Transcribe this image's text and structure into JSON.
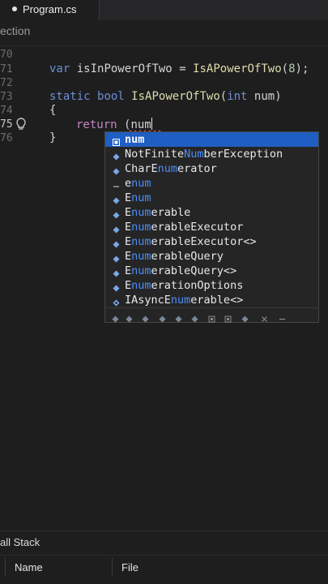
{
  "tab": {
    "filename": "Program.cs"
  },
  "section_label": "ection",
  "editor": {
    "lines": [
      {
        "num": "70"
      },
      {
        "num": "71"
      },
      {
        "num": "72"
      },
      {
        "num": "73"
      },
      {
        "num": "74"
      },
      {
        "num": "75"
      },
      {
        "num": "76"
      }
    ],
    "line71": {
      "kw": "var",
      "name": "isInPowerOfTwo",
      "eq": "=",
      "fn": "IsAPowerOfTwo",
      "open": "(",
      "arg": "8",
      "close": ");"
    },
    "line73": {
      "kw1": "static",
      "kw2": "bool",
      "fn": "IsAPowerOfTwo",
      "open": "(",
      "ptype": "int",
      "pname": "num",
      "close": ")"
    },
    "line74": {
      "text": "{"
    },
    "line75": {
      "kw": "return",
      "text": "(num"
    },
    "line76": {
      "text": "}"
    }
  },
  "completion": {
    "items": [
      {
        "pre": "",
        "match": "num",
        "post": "",
        "kind": "local"
      },
      {
        "pre": "NotFinite",
        "match": "Num",
        "post": "berException",
        "kind": "class"
      },
      {
        "pre": "CharE",
        "match": "num",
        "post": "erator",
        "kind": "class"
      },
      {
        "pre": "e",
        "match": "num",
        "post": "",
        "kind": "keyword"
      },
      {
        "pre": "E",
        "match": "num",
        "post": "",
        "kind": "class"
      },
      {
        "pre": "E",
        "match": "num",
        "post": "erable",
        "kind": "class"
      },
      {
        "pre": "E",
        "match": "num",
        "post": "erableExecutor",
        "kind": "class"
      },
      {
        "pre": "E",
        "match": "num",
        "post": "erableExecutor<>",
        "kind": "class"
      },
      {
        "pre": "E",
        "match": "num",
        "post": "erableQuery",
        "kind": "class"
      },
      {
        "pre": "E",
        "match": "num",
        "post": "erableQuery<>",
        "kind": "class"
      },
      {
        "pre": "E",
        "match": "num",
        "post": "erationOptions",
        "kind": "class"
      },
      {
        "pre": "IAsyncE",
        "match": "num",
        "post": "erable<>",
        "kind": "interface"
      }
    ],
    "filter_icons": [
      "class-filter-icon",
      "struct-filter-icon",
      "interface-filter-icon",
      "enum-filter-icon",
      "delegate-filter-icon",
      "method-filter-icon",
      "local-filter-icon",
      "field-filter-icon",
      "keyword-filter-icon",
      "close-filter-icon",
      "minus-filter-icon"
    ]
  },
  "panel": {
    "title": "all Stack",
    "columns": {
      "name": "Name",
      "file": "File"
    }
  },
  "colors": {
    "background": "#1e1e1f",
    "selection": "#1f5ec2",
    "match": "#4b8ffa",
    "keyword": "#6c8fd6",
    "function": "#dcdcaa"
  }
}
